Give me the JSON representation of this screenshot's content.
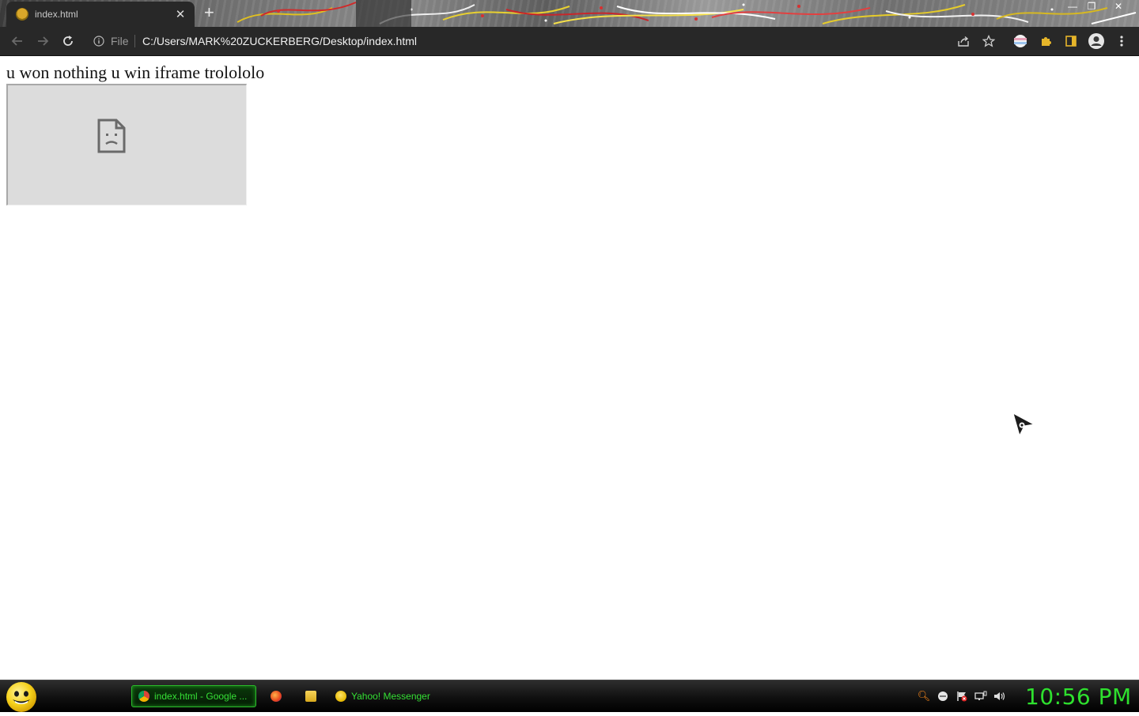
{
  "browser": {
    "tab": {
      "title": "index.html",
      "favicon": "yahoo-smiley-icon"
    },
    "toolbar": {
      "site_label": "File",
      "url": "C:/Users/MARK%20ZUCKERBERG/Desktop/index.html"
    }
  },
  "page": {
    "text": "u won nothing u win iframe trololol​o",
    "iframe_state": "broken-document-icon"
  },
  "taskbar": {
    "tasks": [
      {
        "label": "index.html - Google ...",
        "icon": "chrome-icon",
        "active": true
      },
      {
        "label": "",
        "icon": "firefox-icon"
      },
      {
        "label": "",
        "icon": "folder-icon"
      },
      {
        "label": "Yahoo! Messenger",
        "icon": "yahoo-messenger-icon"
      }
    ],
    "clock": "10:56 PM"
  },
  "colors": {
    "taskbar_accent": "#2ee02e",
    "browser_frame": "#282828",
    "iframe_bg": "#dcdcdc"
  }
}
